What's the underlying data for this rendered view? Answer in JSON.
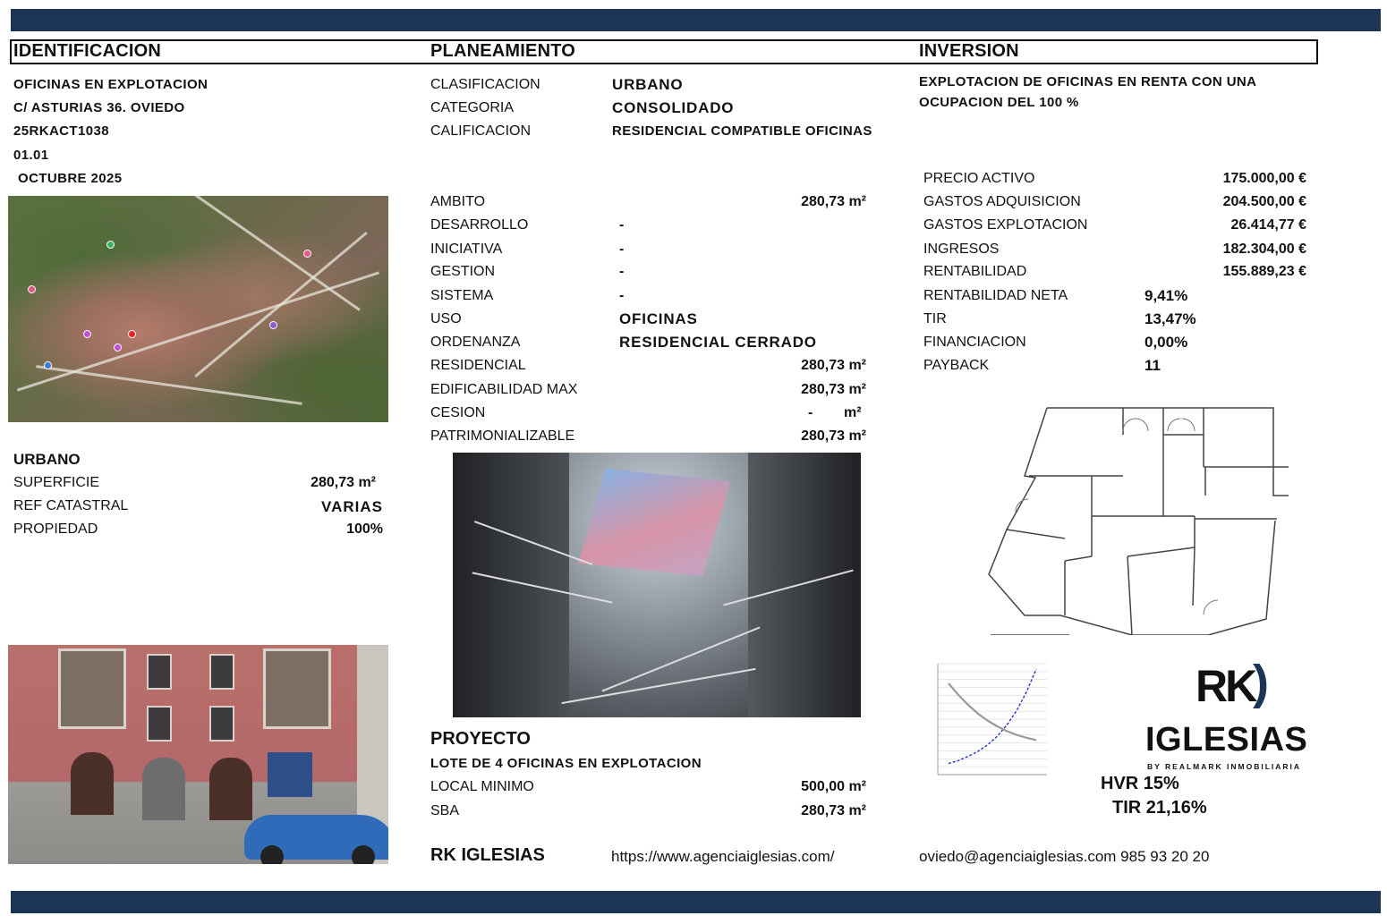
{
  "headers": {
    "identificacion": "IDENTIFICACION",
    "planeamiento": "PLANEAMIENTO",
    "inversion": "INVERSION"
  },
  "identificacion": {
    "line1": "OFICINAS EN EXPLOTACION",
    "line2": "C/ ASTURIAS 36. OVIEDO",
    "line3": "25RKACT1038",
    "line4": "01.01",
    "line5": "OCTUBRE 2025"
  },
  "urbano": {
    "title": "URBANO",
    "rows": [
      {
        "label": "SUPERFICIE",
        "value": "280,73 m²"
      },
      {
        "label": "REF CATASTRAL",
        "value": "VARIAS"
      },
      {
        "label": "PROPIEDAD",
        "value": "100%"
      }
    ]
  },
  "planeamiento": {
    "top": [
      {
        "label": "CLASIFICACION",
        "value": "URBANO"
      },
      {
        "label": "CATEGORIA",
        "value": "CONSOLIDADO"
      },
      {
        "label": "CALIFICACION",
        "value": "RESIDENCIAL COMPATIBLE OFICINAS"
      }
    ],
    "ambito": {
      "label": "AMBITO",
      "value": "280,73 m²"
    },
    "mid": [
      {
        "label": "DESARROLLO",
        "value": "-"
      },
      {
        "label": "INICIATIVA",
        "value": "-"
      },
      {
        "label": "GESTION",
        "value": "-"
      },
      {
        "label": "SISTEMA",
        "value": "-"
      },
      {
        "label": "USO",
        "value": "OFICINAS"
      },
      {
        "label": "ORDENANZA",
        "value": "RESIDENCIAL CERRADO"
      }
    ],
    "bottom": [
      {
        "label": "RESIDENCIAL",
        "value": "280,73 m²"
      },
      {
        "label": "EDIFICABILIDAD MAX",
        "value": "280,73 m²"
      },
      {
        "label": "CESION",
        "value": "-",
        "unit": "m²"
      },
      {
        "label": "PATRIMONIALIZABLE",
        "value": "280,73 m²"
      }
    ]
  },
  "proyecto": {
    "title": "PROYECTO",
    "subtitle": "LOTE DE 4 OFICINAS EN EXPLOTACION",
    "rows": [
      {
        "label": "LOCAL MINIMO",
        "value": "500,00 m²"
      },
      {
        "label": "SBA",
        "value": "280,73 m²"
      }
    ]
  },
  "inversion": {
    "desc1": "EXPLOTACION DE OFICINAS EN RENTA CON UNA",
    "desc2": "OCUPACION DEL 100 %",
    "money": [
      {
        "label": "PRECIO ACTIVO",
        "value": "175.000,00 €"
      },
      {
        "label": "GASTOS ADQUISICION",
        "value": "204.500,00 €"
      },
      {
        "label": "GASTOS EXPLOTACION",
        "value": "26.414,77 €"
      },
      {
        "label": "INGRESOS",
        "value": "182.304,00 €"
      },
      {
        "label": "RENTABILIDAD",
        "value": "155.889,23 €"
      }
    ],
    "ratios": [
      {
        "label": "RENTABILIDAD NETA",
        "value": "9,41%"
      },
      {
        "label": "TIR",
        "value": "13,47%"
      },
      {
        "label": "FINANCIACION",
        "value": "0,00%"
      },
      {
        "label": "PAYBACK",
        "value": "11"
      }
    ],
    "hvr": "HVR 15%",
    "tir": "TIR 21,16%"
  },
  "logo": {
    "rk": "RK",
    "paren": ")",
    "name": "IGLESIAS",
    "tagline": "BY REALMARK INMOBILIARIA"
  },
  "footer": {
    "company": "RK IGLESIAS",
    "website": "https://www.agenciaiglesias.com/",
    "contact": "oviedo@agenciaiglesias.com 985 93 20 20"
  },
  "chart_data": {
    "type": "line",
    "series": [
      {
        "values": [
          0.2,
          0.3,
          0.45,
          0.62,
          0.85,
          1.15,
          1.55,
          2.05,
          2.7,
          3.5
        ]
      },
      {
        "values": [
          3.0,
          2.6,
          2.25,
          1.95,
          1.7,
          1.5,
          1.33,
          1.2,
          1.1,
          1.02
        ]
      }
    ],
    "colors": [
      "#2233cc",
      "#999999"
    ]
  }
}
